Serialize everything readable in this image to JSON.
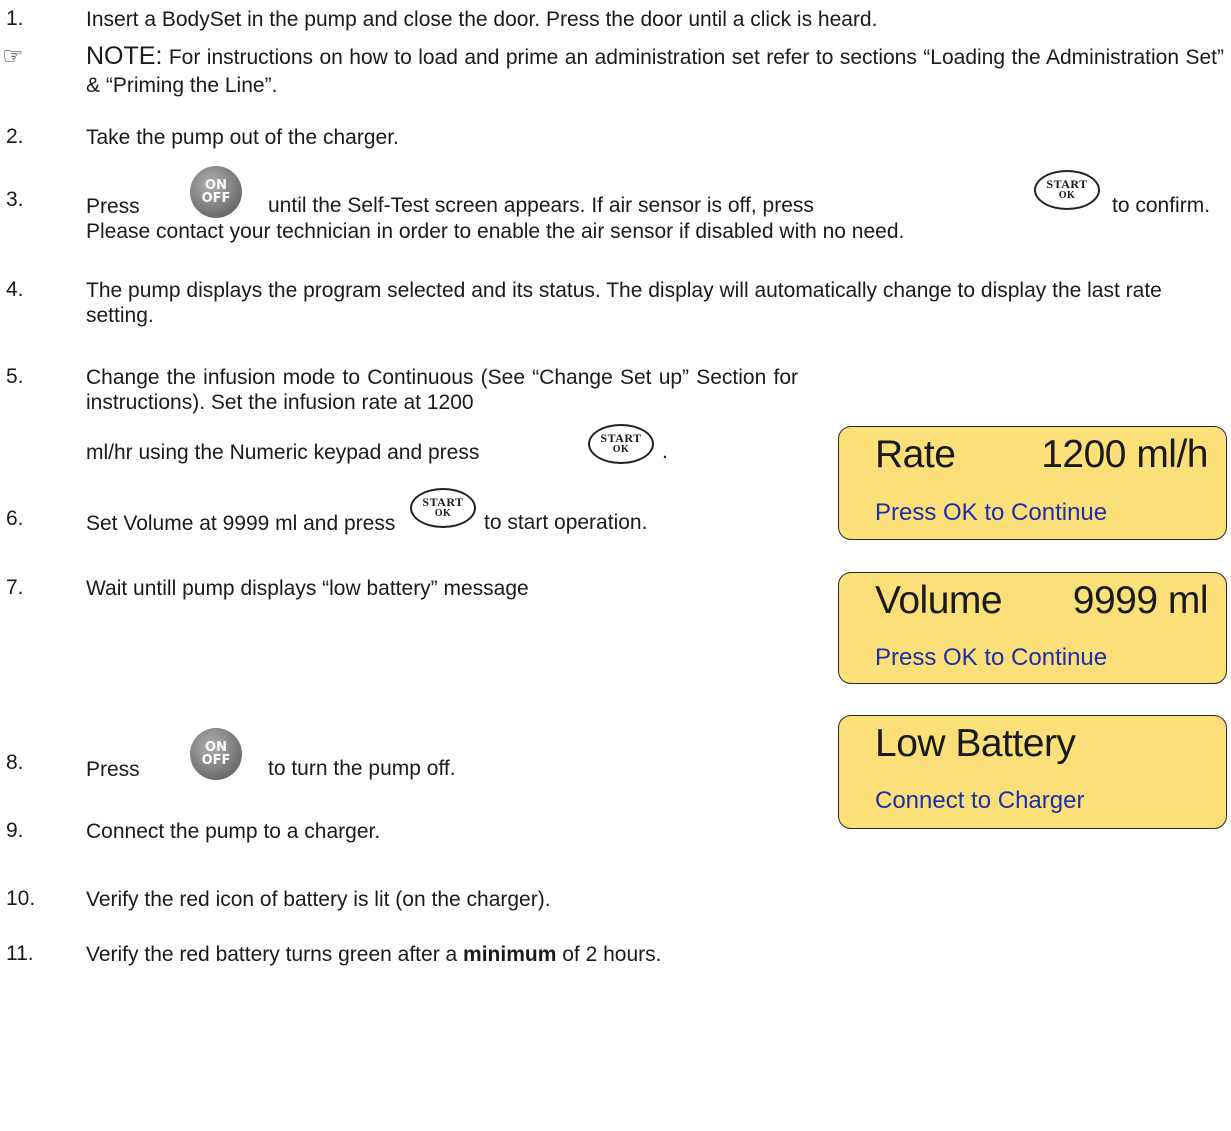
{
  "steps": [
    {
      "num": "1.",
      "text": "Insert a BodySet in the pump and close the door. Press the door until a click is heard."
    },
    {
      "num": "2.",
      "text": "Take the pump out of the charger."
    },
    {
      "num": "3.",
      "pre": "Press",
      "mid": "until the Self-Test screen appears. If air sensor is off, press",
      "post": "to confirm.",
      "line2": "Please contact your technician in order to enable the air sensor if disabled with no need."
    },
    {
      "num": "4.",
      "text": "The pump displays the program selected and its status. The display will automatically change to display the last rate setting."
    },
    {
      "num": "5.",
      "text": "Change the infusion mode to Continuous (See “Change Set up” Section for instructions). Set the infusion rate at 1200",
      "line3_pre": "ml/hr using the Numeric keypad and press",
      "line3_post": "."
    },
    {
      "num": "6.",
      "pre": "Set Volume at 9999 ml and press",
      "post": "to start operation."
    },
    {
      "num": "7.",
      "text": "Wait untill pump displays “low battery” message"
    },
    {
      "num": "8.",
      "pre": "Press",
      "post": "to turn the pump off."
    },
    {
      "num": "9.",
      "text": "Connect the pump to a charger."
    },
    {
      "num": "10.",
      "text": "Verify the red icon of battery is lit (on the charger)."
    },
    {
      "num": "11.",
      "pre": "Verify the red battery turns green after a",
      "bold": "minimum",
      "post": "of 2 hours."
    }
  ],
  "note": {
    "icon": "pointing-hand-icon",
    "glyph": "☞",
    "head": "NOTE:",
    "text": "For instructions on how to load and prime an administration set refer to sections “Loading the Administration Set” & “Priming the Line”."
  },
  "buttons": {
    "onoff": {
      "top": "ON",
      "bottom": "OFF"
    },
    "start": {
      "top": "START",
      "bottom": "OK"
    }
  },
  "displays": [
    {
      "label": "Rate",
      "value": "1200 ml/h",
      "sub": "Press OK to Continue"
    },
    {
      "label": "Volume",
      "value": "9999 ml",
      "sub": "Press OK to Continue"
    },
    {
      "label": "Low Battery",
      "value": "",
      "sub": "Connect to Charger"
    }
  ],
  "colors": {
    "lcd_bg": "#fbe07a",
    "lcd_sub_text": "#1e2ea8",
    "onoff_button": "#7a7a7a"
  }
}
